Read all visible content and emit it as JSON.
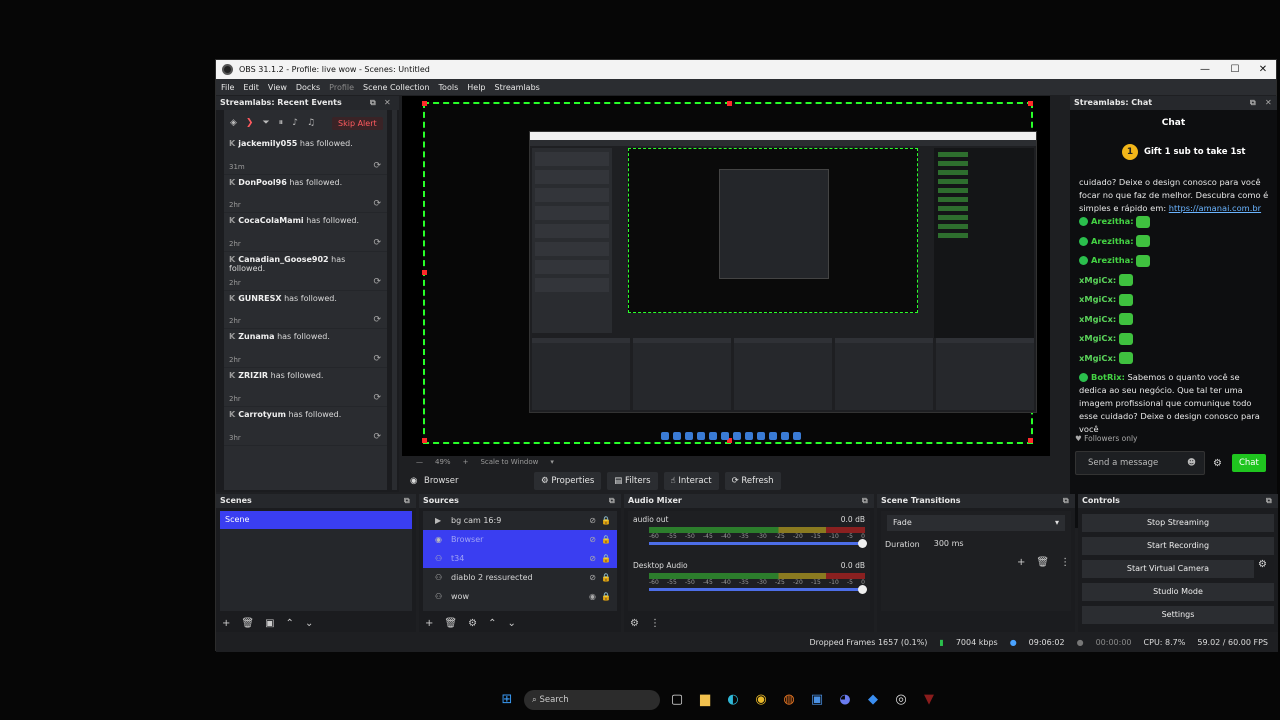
{
  "window": {
    "title": "OBS 31.1.2 - Profile: live wow - Scenes: Untitled"
  },
  "menu": [
    "File",
    "Edit",
    "View",
    "Docks",
    "Profile",
    "Scene Collection",
    "Tools",
    "Help",
    "Streamlabs"
  ],
  "events": {
    "title": "Streamlabs: Recent Events",
    "skip_label": "Skip Alert",
    "items": [
      {
        "name": "jackemily055",
        "text": "has followed.",
        "age": "31m"
      },
      {
        "name": "DonPool96",
        "text": "has followed.",
        "age": "2hr"
      },
      {
        "name": "CocaColaMami",
        "text": "has followed.",
        "age": "2hr"
      },
      {
        "name": "Canadian_Goose902",
        "text": "has followed.",
        "age": "2hr"
      },
      {
        "name": "GUNRESX",
        "text": "has followed.",
        "age": "2hr"
      },
      {
        "name": "Zunama",
        "text": "has followed.",
        "age": "2hr"
      },
      {
        "name": "ZRIZIR",
        "text": "has followed.",
        "age": "2hr"
      },
      {
        "name": "Carrotyum",
        "text": "has followed.",
        "age": "3hr"
      }
    ]
  },
  "preview": {
    "zoom": "49%",
    "scale": "Scale to Window"
  },
  "source_toolbar": {
    "source_name": "Browser",
    "properties": "Properties",
    "filters": "Filters",
    "interact": "Interact",
    "refresh": "Refresh"
  },
  "chat": {
    "title": "Streamlabs: Chat",
    "header": "Chat",
    "gift": "Gift 1 sub to take 1st",
    "gift_num": "1",
    "intro": "cuidado? Deixe o design conosco para você focar no que faz de melhor. Descubra como é simples e rápido em: ",
    "link": "https://amanai.com.br",
    "user_a": "Arezitha:",
    "user_x": "xMgiCx:",
    "bot_user": "BotRix:",
    "bot_msg": " Sabemos o quanto você se dedica ao seu negócio. Que tal ter uma imagem profissional que comunique todo esse cuidado? Deixe o design conosco para você",
    "followers": "Followers only",
    "placeholder": "Send a message",
    "chat_btn": "Chat"
  },
  "scenes": {
    "title": "Scenes",
    "items": [
      "Scene"
    ]
  },
  "sources": {
    "title": "Sources",
    "items": [
      {
        "name": "bg cam 16:9",
        "selected": false
      },
      {
        "name": "Browser",
        "selected": true
      },
      {
        "name": "t34",
        "selected": true
      },
      {
        "name": "diablo 2 ressurected",
        "selected": false
      },
      {
        "name": "wow",
        "selected": false
      }
    ]
  },
  "mixer": {
    "title": "Audio Mixer",
    "channels": [
      {
        "name": "audio out",
        "db": "0.0 dB"
      },
      {
        "name": "Desktop Audio",
        "db": "0.0 dB"
      }
    ],
    "ticks": [
      "-60",
      "-55",
      "-50",
      "-45",
      "-40",
      "-35",
      "-30",
      "-25",
      "-20",
      "-15",
      "-10",
      "-5",
      "0"
    ]
  },
  "transitions": {
    "title": "Scene Transitions",
    "selected": "Fade",
    "duration_label": "Duration",
    "duration": "300 ms"
  },
  "controls": {
    "title": "Controls",
    "buttons": [
      "Stop Streaming",
      "Start Recording",
      "Start Virtual Camera",
      "Studio Mode",
      "Settings"
    ]
  },
  "status": {
    "dropped": "Dropped Frames 1657 (0.1%)",
    "kbps": "7004 kbps",
    "live_time": "09:06:02",
    "rec_time": "00:00:00",
    "cpu": "CPU: 8.7%",
    "fps": "59.02 / 60.00 FPS"
  },
  "taskbar": {
    "search": "Search"
  }
}
